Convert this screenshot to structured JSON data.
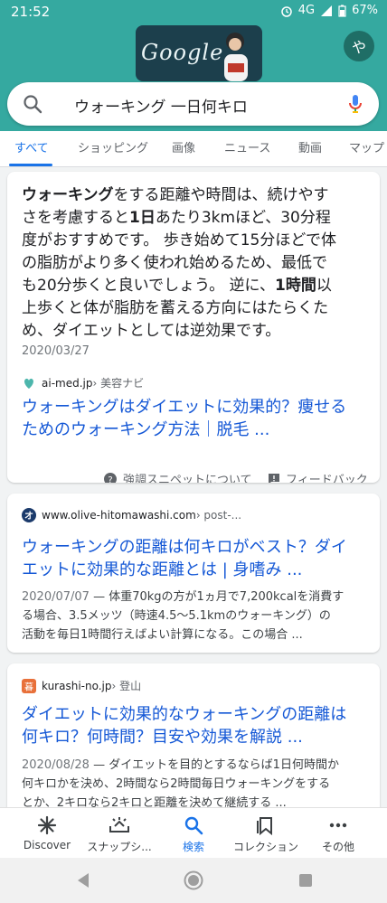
{
  "status": {
    "time": "21:52",
    "network": "4G",
    "battery": "67%"
  },
  "doodle": {
    "text": "Google"
  },
  "avatar": {
    "initial": "や"
  },
  "search": {
    "query": "ウォーキング 一日何キロ"
  },
  "tabs": [
    {
      "label": "すべて",
      "active": true
    },
    {
      "label": "ショッピング"
    },
    {
      "label": "画像"
    },
    {
      "label": "ニュース"
    },
    {
      "label": "動画"
    },
    {
      "label": "マップ"
    }
  ],
  "featured": {
    "snippet_lines": [
      "ウォーキングをする距離や時間は、続けやす",
      "さを考慮すると1日あたり3kmほど、30分程",
      "度がおすすめです。 歩き始めて15分ほどで体",
      "の脂肪がより多く使われ始めるため、最低で",
      "も20分歩くと良いでしょう。 逆に、1時間以",
      "上歩くと体が脂肪を蓄える方向にはたらくた",
      "め、ダイエットとしては逆効果です。"
    ],
    "date": "2020/03/27",
    "source": "ai-med.jp",
    "source_path": " › 美容ナビ",
    "title_lines": [
      "ウォーキングはダイエットに効果的？痩せる",
      "ためのウォーキング方法｜脱毛 ..."
    ],
    "about_label": "強調スニペットについて",
    "feedback_label": "フィードバック"
  },
  "results": [
    {
      "source": "www.olive-hitomawashi.com",
      "source_path": " › post-...",
      "title_lines": [
        "ウォーキングの距離は何キロがベスト？ダイ",
        "エットに効果的な距離とは | 身嗜み ..."
      ],
      "date": "2020/07/07",
      "desc_lines": [
        " — 体重70kgの方が1ヵ月で7,200kcalを消費す",
        "る場合、3.5メッツ（時速4.5〜5.1kmのウォーキング）の",
        "活動を毎日1時間行えばよい計算になる。この場合 ..."
      ]
    },
    {
      "source": "kurashi-no.jp",
      "source_path": " › 登山",
      "title_lines": [
        "ダイエットに効果的なウォーキングの距離は",
        "何キロ？何時間？目安や効果を解説 ..."
      ],
      "date": "2020/08/28",
      "desc_lines": [
        " — ダイエットを目的とするならば1日何時間か",
        "何キロかを決め、2時間なら2時間毎日ウォーキングをする",
        "とか、2キロなら2キロと距離を決めて継続する ..."
      ]
    }
  ],
  "bottom_nav": [
    {
      "label": "Discover",
      "icon": "asterisk-icon"
    },
    {
      "label": "スナップシ...",
      "icon": "snapshot-icon"
    },
    {
      "label": "検索",
      "icon": "search-icon",
      "active": true
    },
    {
      "label": "コレクション",
      "icon": "collections-icon"
    },
    {
      "label": "その他",
      "icon": "more-icon"
    }
  ],
  "colors": {
    "header_teal": "#35a9a0",
    "link_blue": "#1558d6",
    "active_blue": "#1a73e8"
  }
}
